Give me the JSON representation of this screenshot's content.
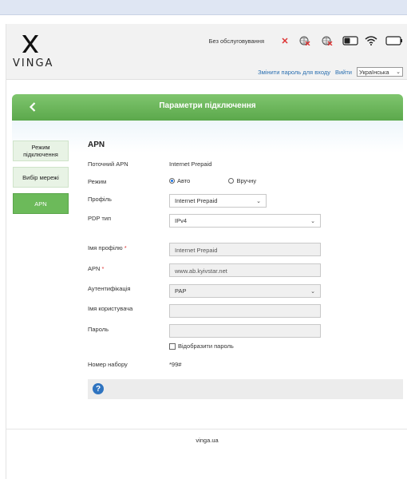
{
  "brand": {
    "name": "VINGA"
  },
  "status": {
    "no_service": "Без обслуговування",
    "icons": [
      "no-sim-icon",
      "signal-off-icon",
      "roaming-off-icon",
      "sms-icon",
      "wifi-icon",
      "battery-icon"
    ],
    "colors": {
      "error": "#d33333"
    }
  },
  "links": {
    "change_password": "Змінити пароль для входу",
    "logout": "Вийти"
  },
  "language": {
    "selected": "Українська"
  },
  "header": {
    "title": "Параметри підключення"
  },
  "colors": {
    "accent_green": "#6cba5a",
    "link_blue": "#2a6fb0",
    "help_blue": "#2f74c0"
  },
  "sidebar": {
    "items": [
      {
        "label": "Режим підключення",
        "active": false
      },
      {
        "label": "Вибір мережі",
        "active": false
      },
      {
        "label": "APN",
        "active": true
      }
    ]
  },
  "apn": {
    "section_title": "APN",
    "current_apn_label": "Поточний APN",
    "current_apn_value": "Internet Prepaid",
    "mode_label": "Режим",
    "mode_auto": "Авто",
    "mode_manual": "Вручну",
    "mode_selected": "auto",
    "profile_label": "Профіль",
    "profile_value": "Internet Prepaid",
    "pdp_label": "PDP тип",
    "pdp_value": "IPv4",
    "profile_name_label": "Імя профілю",
    "profile_name_value": "Internet Prepaid",
    "apn_label": "APN",
    "apn_value": "www.ab.kyivstar.net",
    "auth_label": "Аутентифікація",
    "auth_value": "PAP",
    "username_label": "Імя користувача",
    "username_value": "",
    "password_label": "Пароль",
    "password_value": "",
    "show_password_label": "Відобразити пароль",
    "dial_label": "Номер набору",
    "dial_value": "*99#",
    "required_mark": "*"
  },
  "footer": {
    "text": "vinga.ua"
  }
}
